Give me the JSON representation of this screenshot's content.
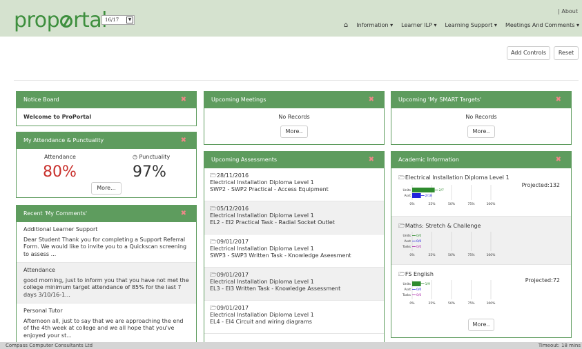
{
  "header": {
    "logo_text": "proportal",
    "logo_pre": "prop",
    "logo_post": "rtal",
    "year": "16/17",
    "about": "| About",
    "nav": [
      "Information",
      "Learner ILP",
      "Learning Support",
      "Meetings And Comments"
    ]
  },
  "toolbar": {
    "add_controls": "Add Controls",
    "reset": "Reset"
  },
  "notice": {
    "title": "Notice Board",
    "text": "Welcome to ProPortal"
  },
  "attendance": {
    "title": "My Attendance & Punctuality",
    "att_label": "Attendance",
    "att_value": "80%",
    "punc_label": "Punctuality",
    "punc_value": "97%",
    "more": "More..."
  },
  "comments": {
    "title": "Recent 'My Comments'",
    "items": [
      {
        "t": "Additional Learner Support",
        "b": "Dear Student Thank you for completing a Support Referral Form. We would like to invite you to a Quickscan screening to assess ..."
      },
      {
        "t": "Attendance",
        "b": "good morning, just to inform you that you have not met the college minimum target attendance of 85% for the last 7 days 3/10/16-1..."
      },
      {
        "t": "Personal Tutor",
        "b": "Afternoon all, just to say that we are approaching the end of the 4th week at college and we all hope that you've enjoyed your st..."
      }
    ]
  },
  "meetings": {
    "title": "Upcoming Meetings",
    "text": "No Records",
    "more": "More.."
  },
  "assessments": {
    "title": "Upcoming Assessments",
    "items": [
      {
        "d": "28/11/2016",
        "c": "Electrical Installation Diploma Level 1",
        "t": "SWP2 - SWP2 Practical - Access Equipment"
      },
      {
        "d": "05/12/2016",
        "c": "Electrical Installation Diploma Level 1",
        "t": "EL2 - EI2 Practical Task - Radial Socket Outlet"
      },
      {
        "d": "09/01/2017",
        "c": "Electrical Installation Diploma Level 1",
        "t": "SWP3 - SWP3 Written Task - Knowledge Aseesment"
      },
      {
        "d": "09/01/2017",
        "c": "Electrical Installation Diploma Level 1",
        "t": "EL3 - EI3 Written Task - Knowledge Assessment"
      },
      {
        "d": "09/01/2017",
        "c": "Electrical Installation Diploma Level 1",
        "t": "EL4 - EI4 Circuit and wiring diagrams"
      }
    ]
  },
  "targets": {
    "title": "Upcoming 'My SMART Targets'",
    "text": "No Records",
    "more": "More.."
  },
  "academic": {
    "title": "Academic Information",
    "more": "More..",
    "items": [
      {
        "name": "Electrical Installation Diploma Level 1",
        "proj": "Projected:132",
        "bars": [
          {
            "l": "Units",
            "v": "2/7",
            "f": 0.286,
            "c": "#2e8b2e"
          },
          {
            "l": "Asst",
            "v": "2/18",
            "f": 0.111,
            "c": "#2222dd"
          }
        ]
      },
      {
        "name": "Maths: Stretch & Challenge",
        "proj": "",
        "bars": [
          {
            "l": "Units",
            "v": "0/0",
            "f": 0,
            "c": "#2e8b2e"
          },
          {
            "l": "Asst",
            "v": "0/0",
            "f": 0,
            "c": "#2222dd"
          },
          {
            "l": "Tasks",
            "v": "0/0",
            "f": 0,
            "c": "#aa22aa"
          }
        ]
      },
      {
        "name": "FS English",
        "proj": "Projected:72",
        "bars": [
          {
            "l": "Units",
            "v": "1/9",
            "f": 0.111,
            "c": "#2e8b2e"
          },
          {
            "l": "Asst",
            "v": "0/0",
            "f": 0,
            "c": "#2222dd"
          },
          {
            "l": "Tasks",
            "v": "0/0",
            "f": 0,
            "c": "#aa22aa"
          }
        ]
      }
    ],
    "ticks": [
      "0%",
      "25%",
      "50%",
      "75%",
      "100%"
    ]
  },
  "footer": {
    "left": "Compass Computer Consultants Ltd",
    "right": "Timeout: 18 mins"
  },
  "colors": {
    "header_bg": "#d5e2cf",
    "panel_green": "#5e9c5e",
    "attendance_red": "#c9302c"
  }
}
